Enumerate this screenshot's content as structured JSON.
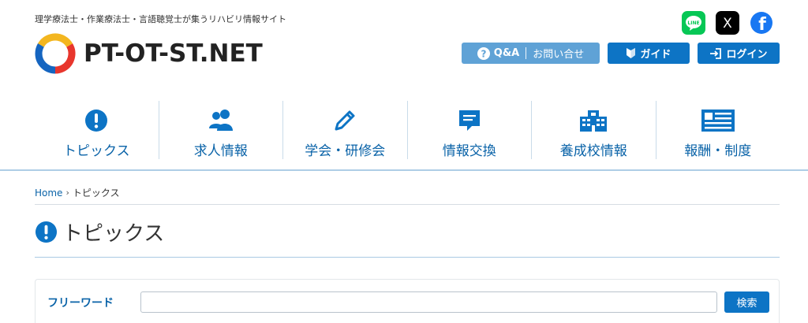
{
  "header": {
    "tagline": "理学療法士・作業療法士・言語聴覚士が集うリハビリ情報サイト",
    "logo_text": "PT-OT-ST.NET"
  },
  "social": [
    {
      "name": "line-icon",
      "label": "LINE",
      "color": "#06c755"
    },
    {
      "name": "x-icon",
      "label": "X",
      "color": "#000000"
    },
    {
      "name": "facebook-icon",
      "label": "f",
      "color": "#1877f2"
    }
  ],
  "top_buttons": {
    "qa_label": "Q&A",
    "contact_label": "お問い合せ",
    "guide_label": "ガイド",
    "login_label": "ログイン"
  },
  "nav": {
    "items": [
      {
        "label": "トピックス",
        "icon": "exclamation-circle-icon"
      },
      {
        "label": "求人情報",
        "icon": "users-icon"
      },
      {
        "label": "学会・研修会",
        "icon": "pencil-icon"
      },
      {
        "label": "情報交換",
        "icon": "message-icon"
      },
      {
        "label": "養成校情報",
        "icon": "school-building-icon"
      },
      {
        "label": "報酬・制度",
        "icon": "newspaper-icon"
      }
    ]
  },
  "breadcrumb": {
    "home": "Home",
    "current": "トピックス"
  },
  "page": {
    "title": "トピックス"
  },
  "search": {
    "label": "フリーワード",
    "value": "",
    "placeholder": "",
    "button_label": "検索"
  },
  "colors": {
    "primary": "#0d74c5",
    "nav_text": "#0a63a8",
    "qa_button": "#5fa2d6"
  }
}
